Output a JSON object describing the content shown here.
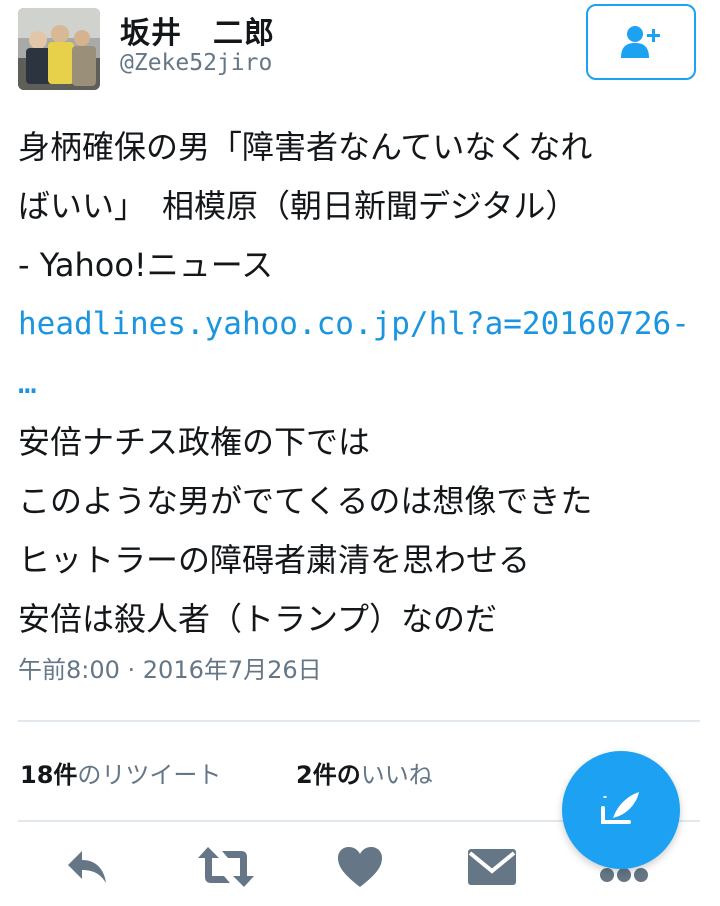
{
  "user": {
    "display_name": "坂井　二郎",
    "handle": "@Zeke52jiro"
  },
  "follow_button": {
    "icon": "add-user-icon"
  },
  "tweet": {
    "lines": [
      "身柄確保の男「障害者なんていなくなれ",
      "ばいい」　相模原（朝日新聞デジタル）",
      "- Yahoo!ニュース"
    ],
    "link_line1": "headlines.yahoo.co.jp/hl?a=20160726-",
    "link_line2": "…",
    "body_lines": [
      "安倍ナチス政権の下では",
      "このような男がでてくるのは想像できた",
      "ヒットラーの障碍者粛清を思わせる",
      "安倍は殺人者（トランプ）なのだ"
    ]
  },
  "timestamp": "午前8:00 · 2016年7月26日",
  "stats": {
    "retweet_count": "18件",
    "retweet_label": "のリツイート",
    "like_count": "2件",
    "like_of": "の",
    "like_label": "いいね"
  },
  "actions": [
    "reply-icon",
    "retweet-icon",
    "heart-icon",
    "direct-message-icon",
    "more-icon"
  ],
  "colors": {
    "accent": "#1da1f2",
    "link": "#1b95e0",
    "muted": "#657786",
    "icon": "#657786"
  }
}
